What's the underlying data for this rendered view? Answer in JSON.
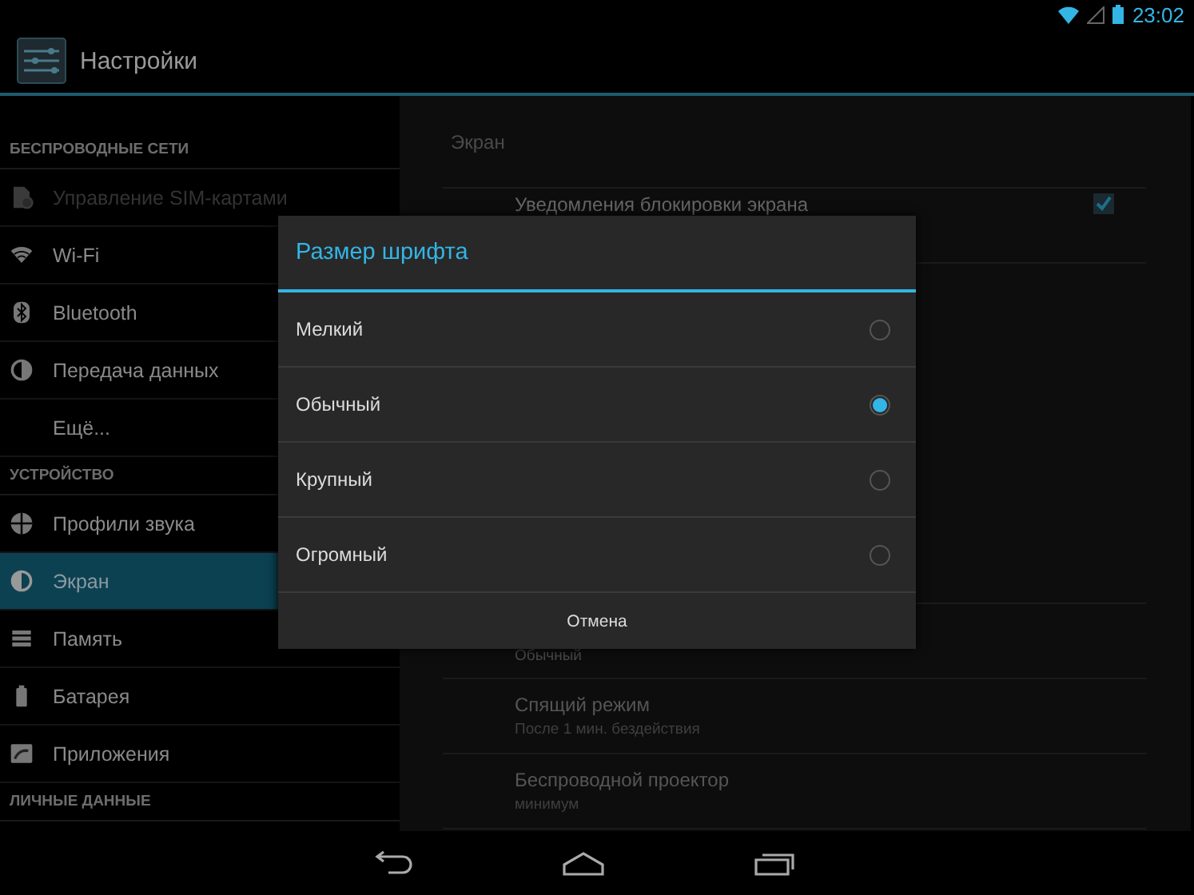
{
  "status_bar": {
    "time": "23:02"
  },
  "action_bar": {
    "title": "Настройки"
  },
  "sidebar": {
    "sections": [
      {
        "header": "БЕСПРОВОДНЫЕ СЕТИ",
        "items": [
          {
            "label": "Управление SIM-картами",
            "disabled": true,
            "selected": false
          },
          {
            "label": "Wi-Fi",
            "disabled": false,
            "selected": false
          },
          {
            "label": "Bluetooth",
            "disabled": false,
            "selected": false
          },
          {
            "label": "Передача данных",
            "disabled": false,
            "selected": false
          },
          {
            "label": "Ещё...",
            "disabled": false,
            "selected": false
          }
        ]
      },
      {
        "header": "УСТРОЙСТВО",
        "items": [
          {
            "label": "Профили звука",
            "disabled": false,
            "selected": false
          },
          {
            "label": "Экран",
            "disabled": false,
            "selected": true
          },
          {
            "label": "Память",
            "disabled": false,
            "selected": false
          },
          {
            "label": "Батарея",
            "disabled": false,
            "selected": false
          },
          {
            "label": "Приложения",
            "disabled": false,
            "selected": false
          }
        ]
      },
      {
        "header": "ЛИЧНЫЕ ДАННЫЕ"
      }
    ]
  },
  "detail": {
    "header": "Экран",
    "top_rows": [
      {
        "title": "Уведомления блокировки экрана",
        "checked": true
      }
    ],
    "bottom_rows": [
      {
        "summary": "Обычный"
      },
      {
        "title": "Спящий режим",
        "summary": "После 1 мин. бездействия"
      },
      {
        "title": "Беспроводной проектор",
        "summary": "минимум"
      }
    ]
  },
  "dialog": {
    "title": "Размер шрифта",
    "options": [
      {
        "label": "Мелкий",
        "selected": false
      },
      {
        "label": "Обычный",
        "selected": true
      },
      {
        "label": "Крупный",
        "selected": false
      },
      {
        "label": "Огромный",
        "selected": false
      }
    ],
    "cancel": "Отмена"
  }
}
